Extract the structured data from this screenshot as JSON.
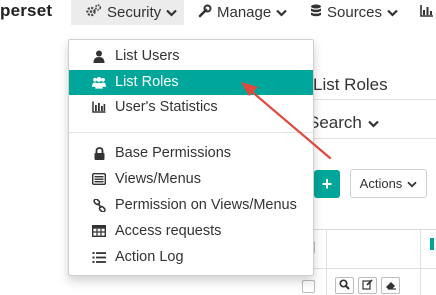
{
  "navbar": {
    "brand": "perset",
    "items": [
      {
        "label": "Security",
        "icon": "cogs-icon"
      },
      {
        "label": "Manage",
        "icon": "wrench-icon"
      },
      {
        "label": "Sources",
        "icon": "database-icon"
      },
      {
        "label": "",
        "icon": "bar-chart-icon"
      }
    ]
  },
  "security_menu": {
    "items": [
      {
        "label": "List Users",
        "icon": "user-icon"
      },
      {
        "label": "List Roles",
        "icon": "group-icon",
        "selected": true
      },
      {
        "label": "User's Statistics",
        "icon": "bar-chart-icon"
      },
      {
        "label": "Base Permissions",
        "icon": "lock-icon"
      },
      {
        "label": "Views/Menus",
        "icon": "list-alt-icon"
      },
      {
        "label": "Permission on Views/Menus",
        "icon": "link-icon"
      },
      {
        "label": "Access requests",
        "icon": "table-icon"
      },
      {
        "label": "Action Log",
        "icon": "list-ol-icon"
      }
    ]
  },
  "page": {
    "title": "List Roles",
    "search_label": "Search",
    "add_label": "+",
    "actions_label": "Actions"
  },
  "colors": {
    "accent": "#00a699",
    "annotation_arrow": "#e0483e"
  }
}
